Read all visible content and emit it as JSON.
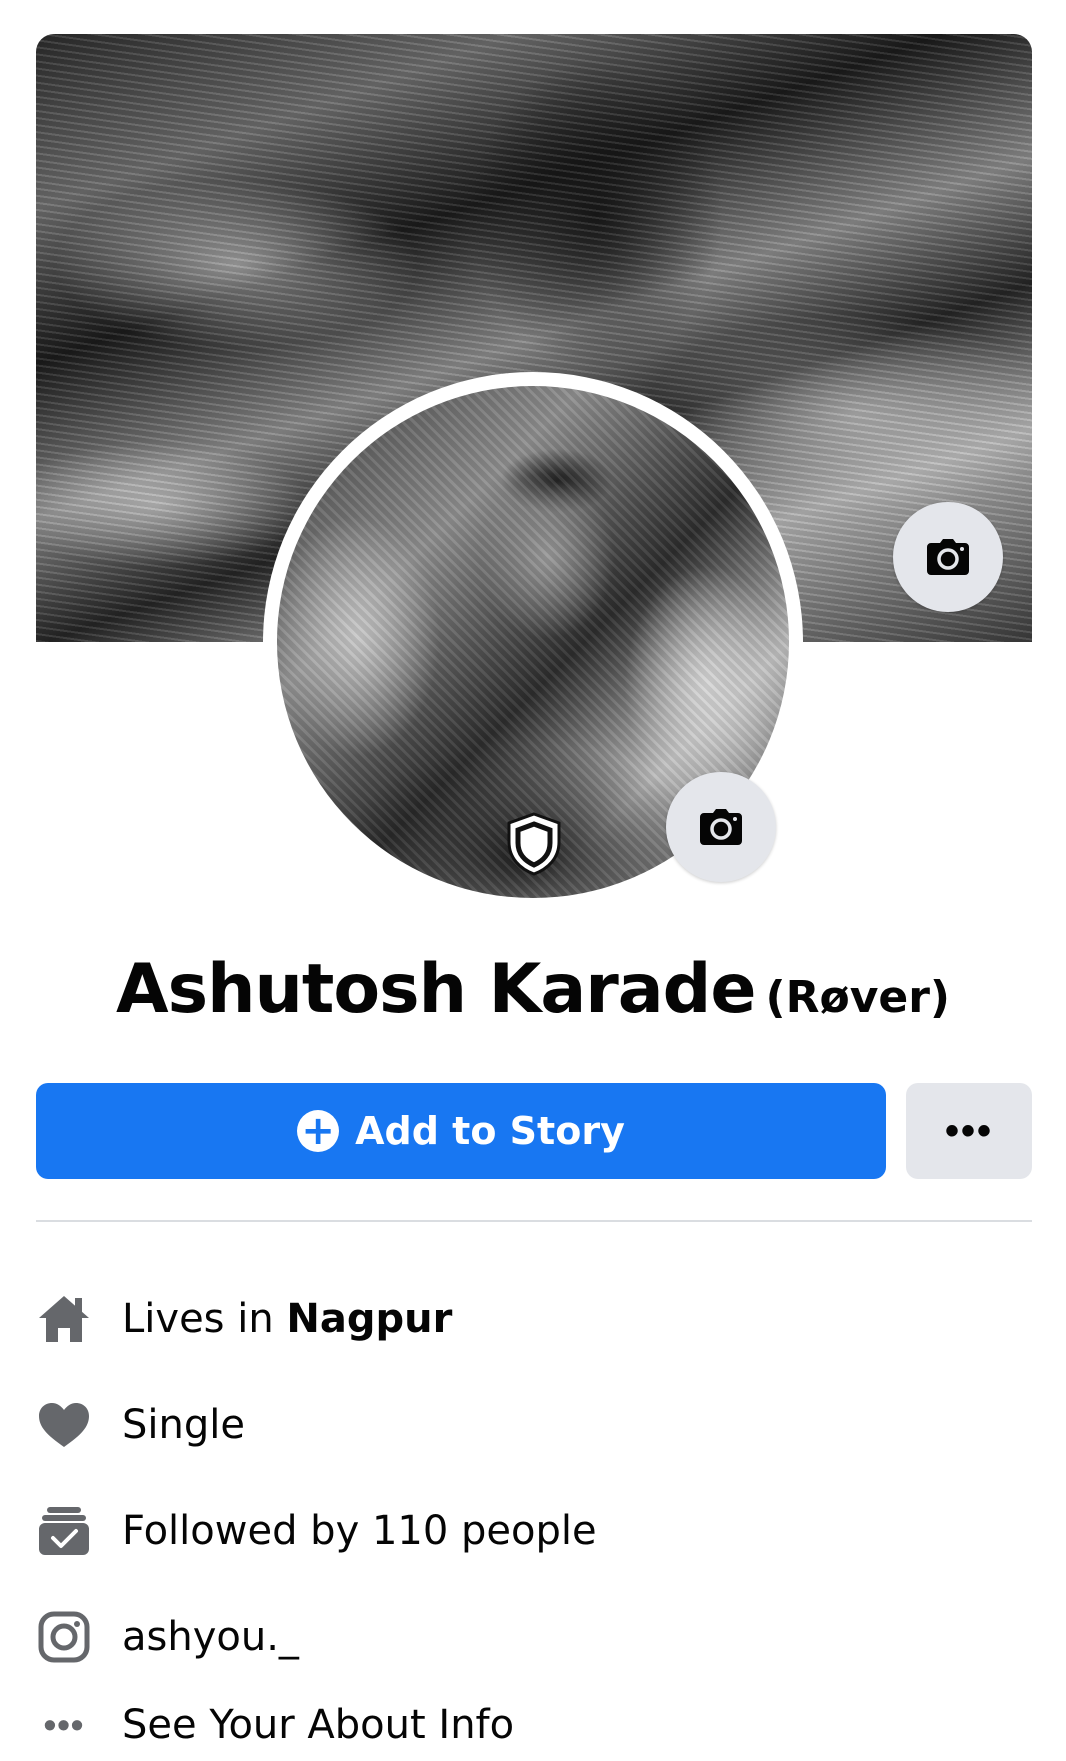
{
  "profile": {
    "name": "Ashutosh Karade",
    "nickname": "(Røver)"
  },
  "actions": {
    "add_story_label": "Add to Story",
    "more_label": "•••"
  },
  "details": {
    "lives_prefix": "Lives in ",
    "lives_city": "Nagpur",
    "relationship": "Single",
    "followers": "Followed by 110 people",
    "instagram": "ashyou._",
    "see_about": "See Your About Info"
  },
  "icons": {
    "cover_camera": "camera-icon",
    "avatar_camera": "camera-icon",
    "profile_guard": "shield-icon",
    "add_story": "plus-circle-icon",
    "home": "home-icon",
    "relationship": "heart-icon",
    "followers": "followers-icon",
    "instagram": "instagram-icon",
    "more": "more-dots-icon"
  },
  "colors": {
    "primary": "#1877f2",
    "secondary_button": "#e4e6eb",
    "icon_gray": "#65676b",
    "text": "#050505",
    "divider": "#dadde1"
  }
}
